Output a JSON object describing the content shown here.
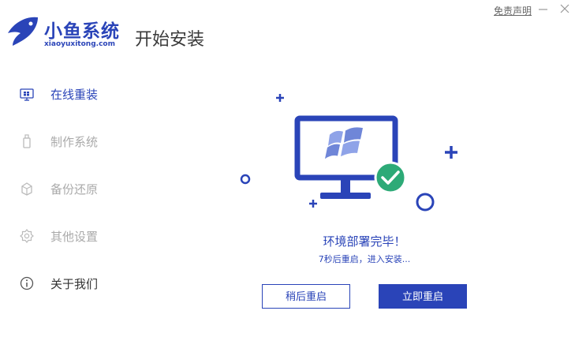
{
  "header": {
    "logo_name": "小鱼系统",
    "logo_domain": "xiaoyuxitong.com",
    "page_title": "开始安装",
    "disclaimer": "免责声明"
  },
  "sidebar": {
    "items": [
      {
        "label": "在线重装",
        "icon": "monitor-icon",
        "state": "active"
      },
      {
        "label": "制作系统",
        "icon": "usb-icon",
        "state": "inactive"
      },
      {
        "label": "备份还原",
        "icon": "backup-icon",
        "state": "inactive"
      },
      {
        "label": "其他设置",
        "icon": "gear-icon",
        "state": "inactive"
      },
      {
        "label": "关于我们",
        "icon": "info-icon",
        "state": "normal"
      }
    ]
  },
  "main": {
    "status_title": "环境部署完毕！",
    "status_sub": "7秒后重启，进入安装...",
    "btn_later": "稍后重启",
    "btn_now": "立即重启"
  },
  "colors": {
    "brand": "#2a44b8",
    "success": "#2daa77",
    "inactive_text": "#aaaaaa"
  }
}
